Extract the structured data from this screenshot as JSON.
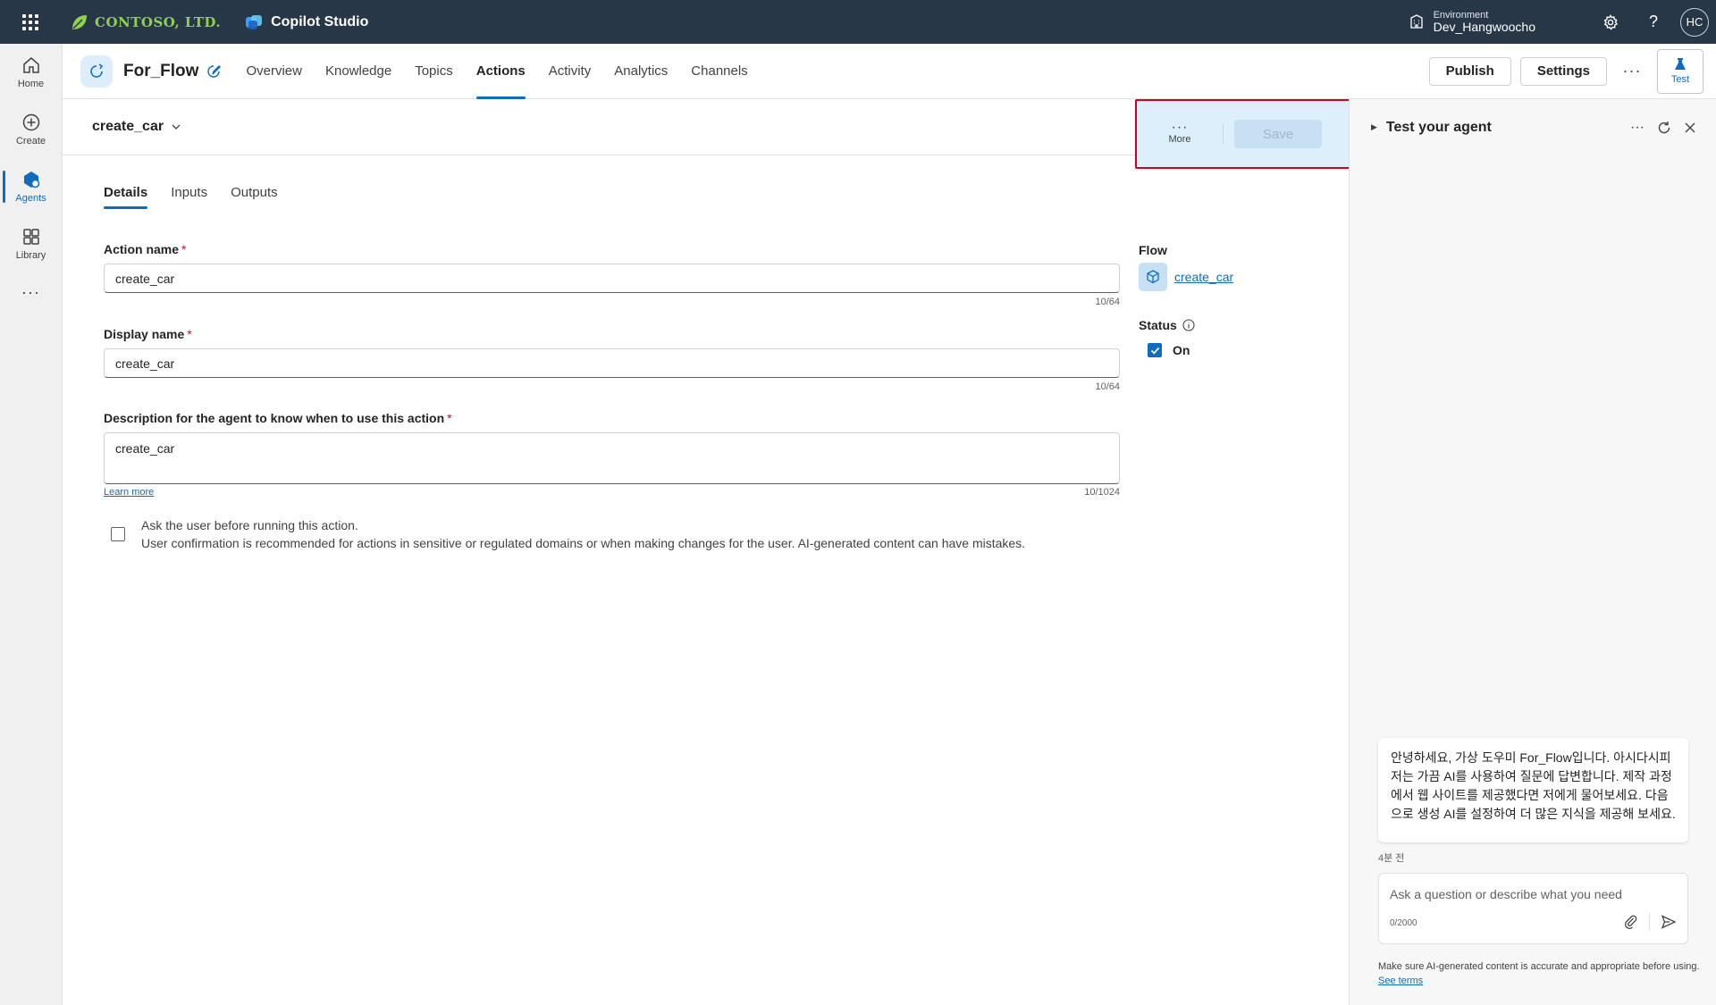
{
  "topbar": {
    "org_name": "CONTOSO, LTD.",
    "product_name": "Copilot Studio",
    "environment_label": "Environment",
    "environment_value": "Dev_Hangwoocho",
    "avatar_initials": "HC"
  },
  "rail": {
    "items": [
      {
        "label": "Home",
        "icon": "home-icon"
      },
      {
        "label": "Create",
        "icon": "plus-circle-icon"
      },
      {
        "label": "Agents",
        "icon": "agents-icon",
        "active": true
      },
      {
        "label": "Library",
        "icon": "library-icon"
      }
    ],
    "more": "···"
  },
  "header": {
    "agent_name": "For_Flow",
    "tabs": [
      {
        "label": "Overview"
      },
      {
        "label": "Knowledge"
      },
      {
        "label": "Topics"
      },
      {
        "label": "Actions",
        "active": true
      },
      {
        "label": "Activity"
      },
      {
        "label": "Analytics"
      },
      {
        "label": "Channels"
      }
    ],
    "publish_label": "Publish",
    "settings_label": "Settings",
    "more_label": "···",
    "test_label": "Test"
  },
  "toolbar": {
    "action_title": "create_car",
    "more_label": "More",
    "save_label": "Save"
  },
  "subtabs": [
    {
      "label": "Details",
      "active": true
    },
    {
      "label": "Inputs"
    },
    {
      "label": "Outputs"
    }
  ],
  "form": {
    "action_name_label": "Action name",
    "action_name_value": "create_car",
    "action_name_count": "10/64",
    "display_name_label": "Display name",
    "display_name_value": "create_car",
    "display_name_count": "10/64",
    "description_label": "Description for the agent to know when to use this action",
    "description_value": "create_car",
    "description_count": "10/1024",
    "learn_more": "Learn more",
    "required_mark": "*",
    "confirm_title": "Ask the user before running this action.",
    "confirm_desc": "User confirmation is recommended for actions in sensitive or regulated domains or when making changes for the user. AI-generated content can have mistakes."
  },
  "side": {
    "flow_label": "Flow",
    "flow_link": "create_car",
    "status_label": "Status",
    "status_value": "On"
  },
  "test_panel": {
    "title": "Test your agent",
    "message": "안녕하세요, 가상 도우미 For_Flow입니다. 아시다시피 저는 가끔 AI를 사용하여 질문에 답변합니다. 제작 과정에서 웹 사이트를 제공했다면 저에게 물어보세요. 다음으로 생성 AI를 설정하여 더 많은 지식을 제공해 보세요.",
    "message_time": "4분 전",
    "input_placeholder": "Ask a question or describe what you need",
    "input_count": "0/2000",
    "disclaimer": "Make sure AI-generated content is accurate and appropriate before using.",
    "see_terms": "See terms"
  },
  "colors": {
    "topbar_bg": "#283748",
    "accent": "#0f6cbd",
    "highlight_border": "#d0021b",
    "highlight_bg": "#ddeffb",
    "org_green": "#8fd14f"
  }
}
